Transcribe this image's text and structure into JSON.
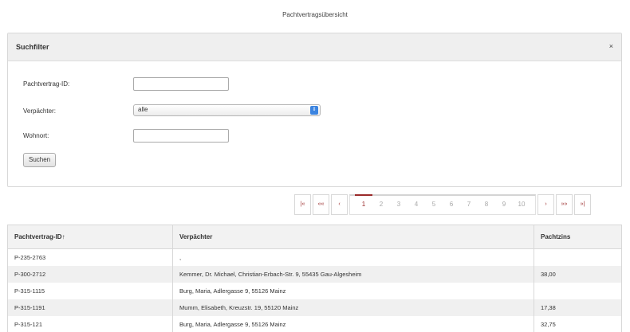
{
  "page": {
    "title": "Pachtvertragsübersicht"
  },
  "filter": {
    "title": "Suchfilter",
    "close_icon": "×",
    "contract_id_label": "Pachtvertrag-ID:",
    "contract_id_value": "",
    "lessor_label": "Verpächter:",
    "lessor_value": "alle",
    "residence_label": "Wohnort:",
    "residence_value": "",
    "search_button": "Suchen"
  },
  "pager": {
    "first": "|«",
    "prev_fast": "««",
    "prev": "‹",
    "pages": [
      "1",
      "2",
      "3",
      "4",
      "5",
      "6",
      "7",
      "8",
      "9",
      "10"
    ],
    "active_page": "1",
    "next": "›",
    "next_fast": "»»",
    "last": "»|"
  },
  "table": {
    "headers": {
      "id": "Pachtvertrag-ID↑",
      "lessor": "Verpächter",
      "rent": "Pachtzins"
    },
    "rows": [
      {
        "id": "P-235-2763",
        "lessor": ",",
        "rent": ""
      },
      {
        "id": "P-300-2712",
        "lessor": "Kemmer, Dr. Michael, Christian-Erbach-Str. 9, 55435 Gau-Algesheim",
        "rent": "38,00"
      },
      {
        "id": "P-315-1115",
        "lessor": "Burg, Maria, Adlergasse 9, 55126 Mainz",
        "rent": ""
      },
      {
        "id": "P-315-1191",
        "lessor": "Mumm, Elisabeth, Kreuzstr. 19, 55120 Mainz",
        "rent": "17,38"
      },
      {
        "id": "P-315-121",
        "lessor": "Burg, Maria, Adlergasse 9, 55126 Mainz",
        "rent": "32,75"
      }
    ]
  }
}
